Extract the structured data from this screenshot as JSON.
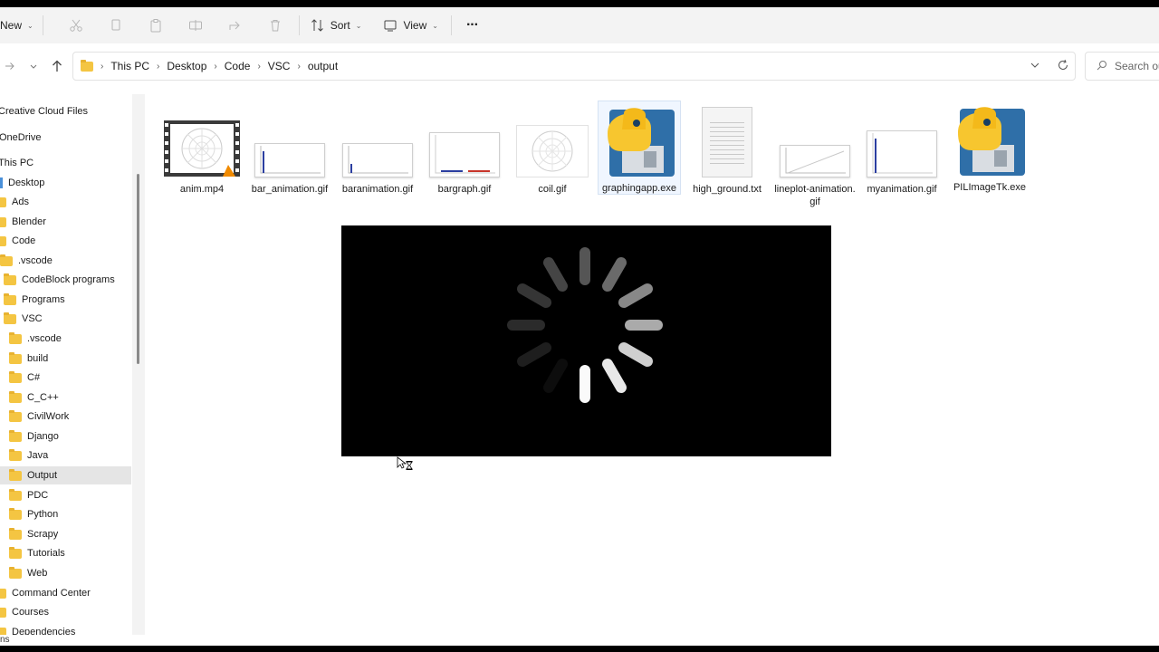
{
  "toolbar": {
    "new_label": "New",
    "sort_label": "Sort",
    "view_label": "View",
    "more_label": "···"
  },
  "address": {
    "crumbs": [
      "This PC",
      "Desktop",
      "Code",
      "VSC",
      "output"
    ],
    "search_placeholder": "Search ou"
  },
  "sidebar": {
    "items": [
      {
        "label": "Creative Cloud Files"
      },
      {
        "label": "OneDrive"
      },
      {
        "label": "This PC"
      },
      {
        "label": "Desktop"
      },
      {
        "label": "Ads"
      },
      {
        "label": "Blender"
      },
      {
        "label": "Code"
      },
      {
        "label": ".vscode"
      },
      {
        "label": "CodeBlock programs"
      },
      {
        "label": "Programs"
      },
      {
        "label": "VSC"
      },
      {
        "label": ".vscode"
      },
      {
        "label": "build"
      },
      {
        "label": "C#"
      },
      {
        "label": "C_C++"
      },
      {
        "label": "CivilWork"
      },
      {
        "label": "Django"
      },
      {
        "label": "Java"
      },
      {
        "label": "Output"
      },
      {
        "label": "PDC"
      },
      {
        "label": "Python"
      },
      {
        "label": "Scrapy"
      },
      {
        "label": "Tutorials"
      },
      {
        "label": "Web"
      },
      {
        "label": "Command Center"
      },
      {
        "label": "Courses"
      },
      {
        "label": "Dependencies"
      }
    ]
  },
  "files": [
    {
      "name": "anim.mp4",
      "icon": "video-thumbnail-icon"
    },
    {
      "name": "bar_animation.gif",
      "icon": "gif-thumbnail-icon"
    },
    {
      "name": "baranimation.gif",
      "icon": "gif-thumbnail-icon"
    },
    {
      "name": "bargraph.gif",
      "icon": "gif-thumbnail-icon"
    },
    {
      "name": "coil.gif",
      "icon": "gif-thumbnail-icon"
    },
    {
      "name": "graphingapp.exe",
      "icon": "python-exe-icon"
    },
    {
      "name": "high_ground.txt",
      "icon": "text-file-icon"
    },
    {
      "name": "lineplot-animation.gif",
      "icon": "gif-thumbnail-icon"
    },
    {
      "name": "myanimation.gif",
      "icon": "gif-thumbnail-icon"
    },
    {
      "name": "PILImageTk.exe",
      "icon": "python-exe-icon"
    }
  ],
  "status": {
    "text": "ns"
  },
  "colors": {
    "folder": "#f4c542",
    "selected": "#e5e5e5",
    "accent": "#0067c0"
  }
}
